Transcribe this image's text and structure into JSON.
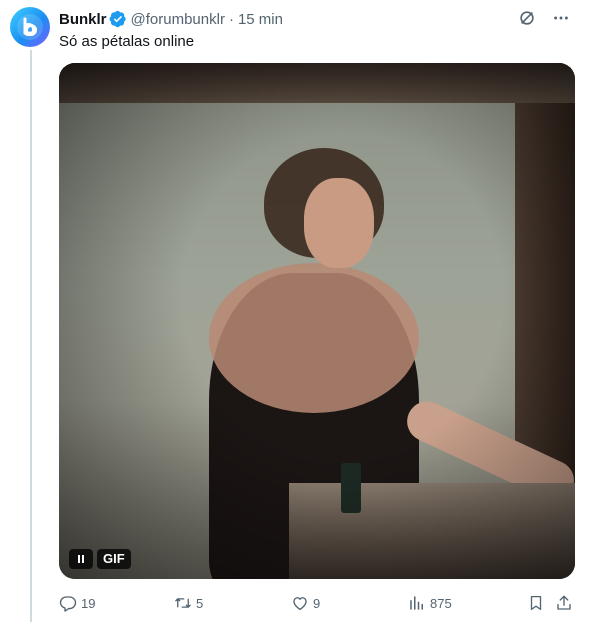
{
  "tweet": {
    "author_name": "Bunklr",
    "handle": "@forumbunklr",
    "separator": "·",
    "time": "15 min",
    "text": "Só as pétalas online",
    "media": {
      "badge": "GIF",
      "state": "playing"
    },
    "stats": {
      "replies": "19",
      "retweets": "5",
      "likes": "9",
      "views": "875"
    }
  },
  "colors": {
    "verified": "#1d9bf0",
    "muted_text": "#536471",
    "primary_text": "#0f1419",
    "thread_line": "#cfd9de"
  },
  "icons": [
    "avatar-logo",
    "verified-badge-icon",
    "grok-icon",
    "more-icon",
    "pause-icon",
    "reply-icon",
    "retweet-icon",
    "like-icon",
    "views-icon",
    "bookmark-icon",
    "share-icon"
  ]
}
